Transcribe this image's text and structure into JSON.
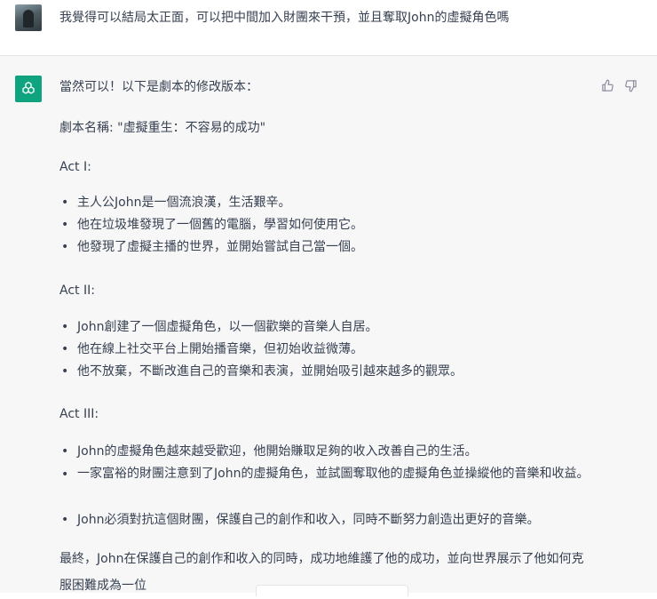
{
  "user": {
    "message": "我覺得可以結局太正面，可以把中間加入財團來干預，並且奪取John的虛擬角色嗎"
  },
  "assistant": {
    "intro": "當然可以！以下是劇本的修改版本：",
    "script_title": "劇本名稱: \"虛擬重生：不容易的成功\"",
    "acts": [
      {
        "heading": "Act I:",
        "items": [
          "主人公John是一個流浪漢，生活艱辛。",
          "他在垃圾堆發現了一個舊的電腦，學習如何使用它。",
          "他發現了虛擬主播的世界，並開始嘗試自己當一個。"
        ]
      },
      {
        "heading": "Act II:",
        "items": [
          "John創建了一個虛擬角色，以一個歡樂的音樂人自居。",
          "他在線上社交平台上開始播音樂，但初始收益微薄。",
          "他不放棄，不斷改進自己的音樂和表演，並開始吸引越來越多的觀眾。"
        ]
      },
      {
        "heading": "Act III:",
        "items": [
          "John的虛擬角色越來越受歡迎，他開始賺取足夠的收入改善自己的生活。",
          "一家富裕的財團注意到了John的虛擬角色，並試圖奪取他的虛擬角色並操縱他的音樂和收益。",
          "John必須對抗這個財團，保護自己的創作和收入，同時不斷努力創造出更好的音樂。"
        ]
      }
    ],
    "conclusion": "最終，John在保護自己的創作和收入的同時，成功地維護了他的成功，並向世界展示了他如何克服困難成為一位"
  },
  "icons": {
    "assistant_logo": "openai-logo-icon",
    "thumbs_up": "thumbs-up-icon",
    "thumbs_down": "thumbs-down-icon"
  },
  "colors": {
    "assistant_bg": "#f7f7f8",
    "brand": "#10a37f",
    "text": "#374151"
  }
}
